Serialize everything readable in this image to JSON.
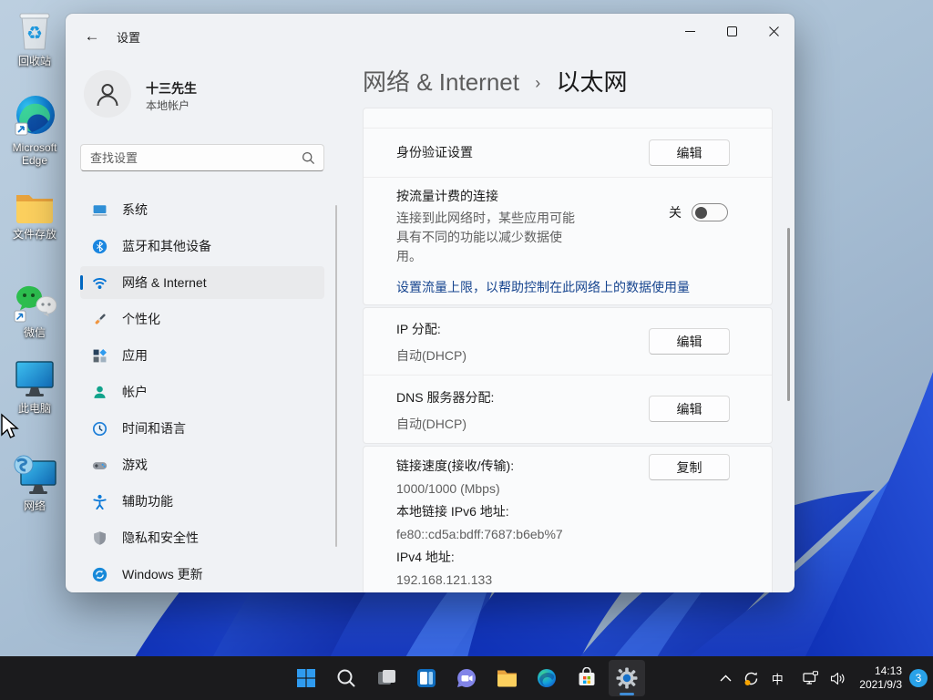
{
  "desktop": {
    "icons": [
      {
        "label": "回收站"
      },
      {
        "label": "Microsoft Edge"
      },
      {
        "label": "文件存放"
      },
      {
        "label": "微信"
      },
      {
        "label": "此电脑"
      },
      {
        "label": "网络"
      }
    ]
  },
  "window": {
    "titlebar": {
      "title": "设置"
    },
    "user": {
      "name": "十三先生",
      "type": "本地帐户"
    },
    "search": {
      "placeholder": "查找设置"
    },
    "nav": [
      {
        "label": "系统",
        "icon": "system-icon"
      },
      {
        "label": "蓝牙和其他设备",
        "icon": "bluetooth-icon"
      },
      {
        "label": "网络 & Internet",
        "icon": "wifi-icon",
        "selected": true
      },
      {
        "label": "个性化",
        "icon": "personalization-icon"
      },
      {
        "label": "应用",
        "icon": "apps-icon"
      },
      {
        "label": "帐户",
        "icon": "accounts-icon"
      },
      {
        "label": "时间和语言",
        "icon": "time-language-icon"
      },
      {
        "label": "游戏",
        "icon": "gaming-icon"
      },
      {
        "label": "辅助功能",
        "icon": "accessibility-icon"
      },
      {
        "label": "隐私和安全性",
        "icon": "privacy-icon"
      },
      {
        "label": "Windows 更新",
        "icon": "windows-update-icon"
      }
    ],
    "content": {
      "breadcrumb": {
        "parent": "网络 & Internet",
        "separator": "›",
        "current": "以太网"
      },
      "auth": {
        "label": "身份验证设置",
        "button": "编辑"
      },
      "metered": {
        "title": "按流量计费的连接",
        "desc": "连接到此网络时，某些应用可能具有不同的功能以减少数据使用。",
        "state": "关",
        "link": "设置流量上限，以帮助控制在此网络上的数据使用量"
      },
      "ip": {
        "label": "IP 分配:",
        "value": "自动(DHCP)",
        "button": "编辑"
      },
      "dns": {
        "label": "DNS 服务器分配:",
        "value": "自动(DHCP)",
        "button": "编辑"
      },
      "details": {
        "speed_label": "链接速度(接收/传输):",
        "speed_value": "1000/1000 (Mbps)",
        "ipv6_label": "本地链接 IPv6 地址:",
        "ipv6_value": "fe80::cd5a:bdff:7687:b6eb%7",
        "ipv4_label": "IPv4 地址:",
        "ipv4_value": "192.168.121.133",
        "button": "复制"
      }
    }
  },
  "taskbar": {
    "tray": {
      "ime": "中",
      "time": "14:13",
      "date": "2021/9/3",
      "badge": "3"
    }
  },
  "colors": {
    "accent": "#0067c0",
    "link": "#17458f",
    "badge": "#29a2e9"
  }
}
